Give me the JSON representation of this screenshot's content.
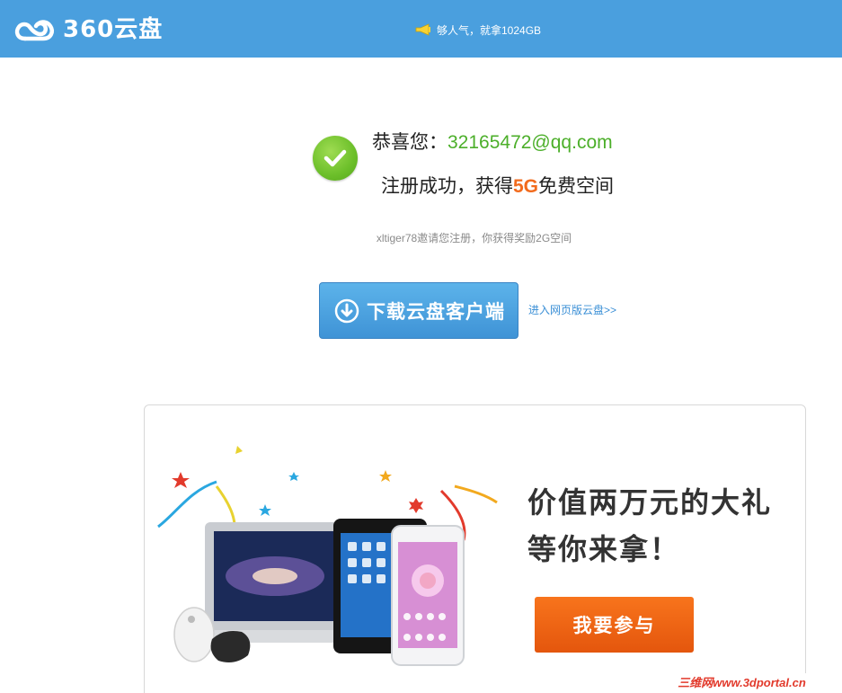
{
  "header": {
    "brand": "360云盘",
    "promo_text": "够人气，就拿1024GB",
    "accent": "#4a9fde"
  },
  "success": {
    "greeting": "恭喜您：",
    "email": "32165472@qq.com",
    "reg_prefix": "注册成功，获得",
    "reg_amount": "5G",
    "reg_suffix": "免费空间",
    "invite_text": "xltiger78邀请您注册，你获得奖励2G空间"
  },
  "actions": {
    "download_label": "下载云盘客户端",
    "web_link_label": "进入网页版云盘>>"
  },
  "promo_card": {
    "title_line1": "价值两万元的大礼",
    "title_line2": "等你来拿！",
    "join_label": "我要参与"
  },
  "watermark": "三维网www.3dportal.cn"
}
